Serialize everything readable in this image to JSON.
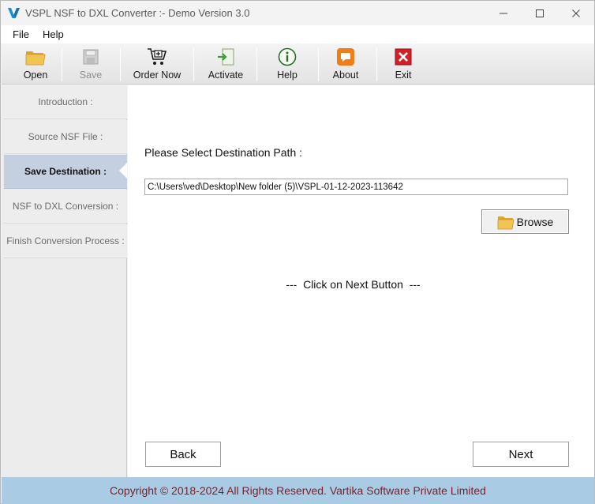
{
  "window": {
    "title": "VSPL NSF to DXL Converter :- Demo Version 3.0",
    "controls": {
      "minimize": "minimize-icon",
      "maximize": "maximize-icon",
      "close": "close-icon"
    }
  },
  "menu": {
    "file": "File",
    "help": "Help"
  },
  "toolbar": {
    "open": "Open",
    "save": "Save",
    "order_now": "Order Now",
    "activate": "Activate",
    "help": "Help",
    "about": "About",
    "exit": "Exit"
  },
  "steps": [
    {
      "label": "Introduction :",
      "active": false
    },
    {
      "label": "Source NSF File :",
      "active": false
    },
    {
      "label": "Save Destination :",
      "active": true
    },
    {
      "label": "NSF to DXL Conversion :",
      "active": false
    },
    {
      "label": "Finish Conversion Process :",
      "active": false
    }
  ],
  "main": {
    "destination_label": "Please Select Destination Path :",
    "destination_path": "C:\\Users\\ved\\Desktop\\New folder (5)\\VSPL-01-12-2023-113642",
    "browse_label": "Browse",
    "hint": "---  Click on Next Button  ---",
    "back_label": "Back",
    "next_label": "Next"
  },
  "footer": {
    "copyright": "Copyright © 2018-2024 All Rights Reserved. Vartika Software Private Limited"
  },
  "colors": {
    "active_step": "#c4d0e0",
    "footer_bg": "#a9cbe4",
    "footer_text": "#7d1f2a",
    "exit_red": "#d32027",
    "about_orange": "#f07c1a",
    "folder_yellow": "#f2c451"
  }
}
